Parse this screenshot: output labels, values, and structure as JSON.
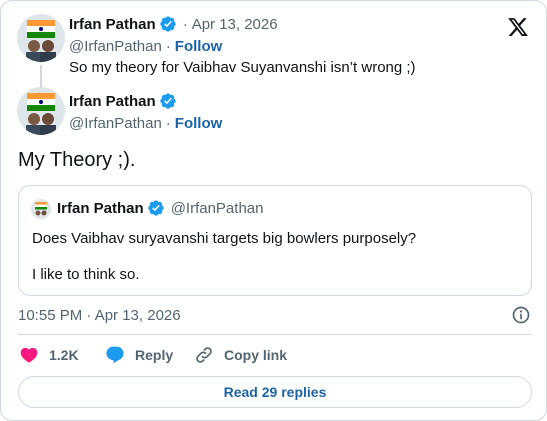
{
  "parent_tweet": {
    "author_name": "Irfan Pathan",
    "separator": "·",
    "date": "Apr 13, 2026",
    "handle": "@IrfanPathan",
    "follow_label": "Follow",
    "text": "So my theory for Vaibhav Suyanvanshi isn’t wrong ;)"
  },
  "main_tweet": {
    "author_name": "Irfan Pathan",
    "handle": "@IrfanPathan",
    "separator": "·",
    "follow_label": "Follow",
    "text": "My Theory ;).",
    "timestamp": "10:55 PM · Apr 13, 2026"
  },
  "quoted_tweet": {
    "author_name": "Irfan Pathan",
    "handle": "@IrfanPathan",
    "line1": "Does Vaibhav suryavanshi targets big bowlers purposely?",
    "line2": "I like to think so."
  },
  "actions": {
    "likes_count": "1.2K",
    "reply_label": "Reply",
    "copy_link_label": "Copy link",
    "read_replies_label": "Read 29 replies"
  },
  "icons": [
    "x-logo-icon",
    "verified-badge-icon",
    "info-icon",
    "heart-icon",
    "reply-bubble-icon",
    "link-icon"
  ],
  "colors": {
    "verified_blue": "#1d9bf0",
    "link_blue": "#1d63a5",
    "like_pink": "#f91880",
    "muted": "#536471",
    "border": "#cfd9de"
  }
}
